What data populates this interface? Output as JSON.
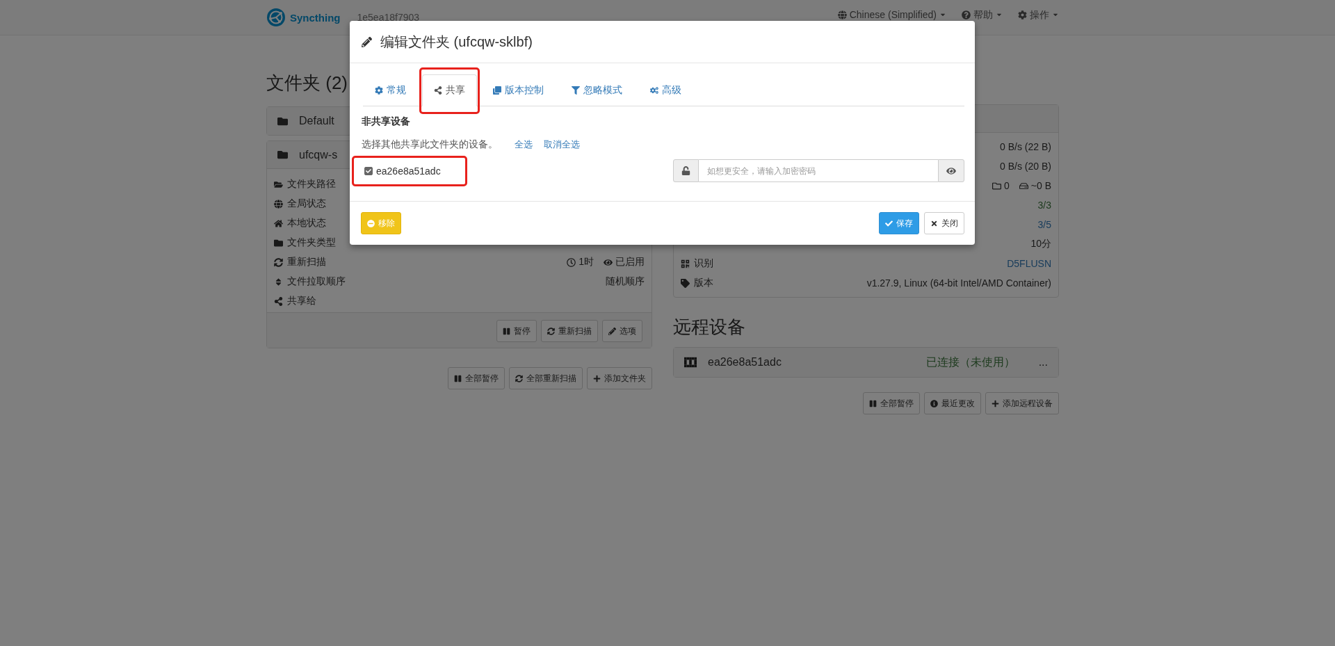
{
  "navbar": {
    "brand": "Syncthing",
    "device_id": "1e5ea18f7903",
    "menus": [
      {
        "label": "Chinese (Simplified)"
      },
      {
        "label": "帮助"
      },
      {
        "label": "操作"
      }
    ]
  },
  "folders": {
    "title": "文件夹 (2)",
    "items": [
      {
        "name": "Default",
        "expanded": false
      },
      {
        "name": "ufcqw-s",
        "expanded": true,
        "rows": [
          {
            "label": "文件夹路径"
          },
          {
            "label": "全局状态"
          },
          {
            "label": "本地状态"
          },
          {
            "label": "文件夹类型"
          },
          {
            "label": "重新扫描",
            "values": [
              "1时",
              "已启用"
            ]
          },
          {
            "label": "文件拉取顺序",
            "values": [
              "随机顺序"
            ]
          },
          {
            "label": "共享给"
          }
        ],
        "buttons": [
          "暂停",
          "重新扫描",
          "选项"
        ]
      }
    ],
    "buttons": [
      "全部暂停",
      "全部重新扫描",
      "添加文件夹"
    ]
  },
  "this_device": {
    "rows": [
      {
        "kind": "plain",
        "values": [
          "0 B/s (22 B)"
        ]
      },
      {
        "kind": "plain",
        "values": [
          "0 B/s (20 B)"
        ]
      },
      {
        "kind": "counts",
        "values": [
          "0",
          "~0 B"
        ]
      },
      {
        "kind": "success",
        "values": [
          "3/3"
        ]
      },
      {
        "kind": "link",
        "values": [
          "3/5"
        ]
      },
      {
        "kind": "plain",
        "values": [
          "10分"
        ]
      },
      {
        "kind": "link",
        "label": "识别",
        "values": [
          "D5FLUSN"
        ]
      },
      {
        "kind": "plain",
        "label": "版本",
        "values": [
          "v1.27.9, Linux (64-bit Intel/AMD Container)"
        ]
      }
    ]
  },
  "remote_devices": {
    "title": "远程设备",
    "items": [
      {
        "name": "ea26e8a51adc",
        "status": "已连接（未使用）",
        "more": "..."
      }
    ],
    "buttons": [
      "全部暂停",
      "最近更改",
      "添加远程设备"
    ]
  },
  "dialog": {
    "title": "编辑文件夹 (ufcqw-sklbf)",
    "tabs": [
      {
        "label": "常规",
        "selected": false,
        "highlighted": false
      },
      {
        "label": "共享",
        "selected": true,
        "highlighted": true
      },
      {
        "label": "版本控制",
        "selected": false,
        "highlighted": false
      },
      {
        "label": "忽略模式",
        "selected": false,
        "highlighted": false
      },
      {
        "label": "高级",
        "selected": false,
        "highlighted": false
      }
    ],
    "section_title": "非共享设备",
    "description": "选择其他共享此文件夹的设备。",
    "select_all": "全选",
    "deselect_all": "取消全选",
    "devices": [
      {
        "name": "ea26e8a51adc",
        "checked": true,
        "highlighted": true,
        "password_placeholder": "如想更安全，请输入加密密码"
      }
    ],
    "buttons": {
      "remove": "移除",
      "save": "保存",
      "close": "关闭"
    }
  }
}
